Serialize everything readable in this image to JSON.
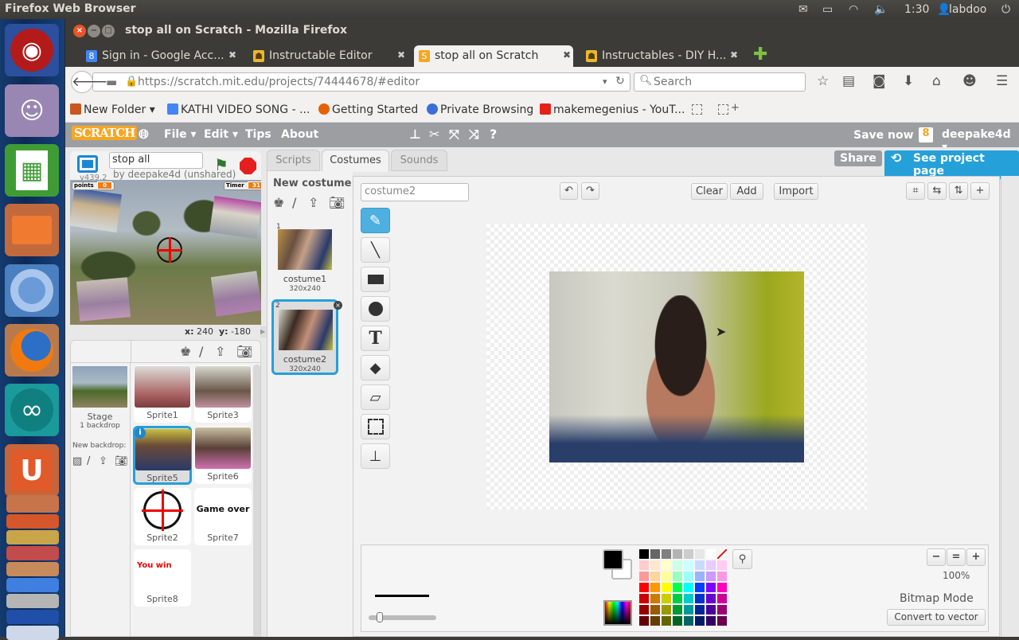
{
  "system": {
    "app_name": "Firefox Web Browser",
    "clock": "1:30",
    "user": "labdoo",
    "indicators": [
      "mail-icon",
      "battery-icon",
      "wifi-icon",
      "volume-icon"
    ]
  },
  "launcher": {
    "items": [
      {
        "name": "ubuntu-dash",
        "glyph": "◉",
        "color": "#b31b1b"
      },
      {
        "name": "cheese-webcam",
        "glyph": "☺",
        "color": "#9a7fb0"
      },
      {
        "name": "libreoffice-calc",
        "glyph": "▦",
        "color": "#3f9c35"
      },
      {
        "name": "files",
        "glyph": "▬",
        "color": "#c36a3d"
      },
      {
        "name": "chromium",
        "glyph": "◎",
        "color": "#4a7fc0"
      },
      {
        "name": "firefox",
        "glyph": "◐",
        "color": "#b87a4d"
      },
      {
        "name": "arduino",
        "glyph": "∞",
        "color": "#1a9a9a"
      },
      {
        "name": "ubuntu-one",
        "glyph": "U",
        "color": "#d4562a"
      }
    ]
  },
  "window": {
    "title": "stop all on Scratch - Mozilla Firefox",
    "tabs": [
      {
        "label": "Sign in - Google Acc...",
        "icon": "google-icon",
        "active": false
      },
      {
        "label": "Instructable Editor",
        "icon": "instructables-icon",
        "active": false
      },
      {
        "label": "stop all on Scratch",
        "icon": "scratch-icon",
        "active": true
      },
      {
        "label": "Instructables - DIY H...",
        "icon": "instructables-icon",
        "active": false
      }
    ],
    "url": "https://scratch.mit.edu/projects/74444678/#editor",
    "search_placeholder": "Search",
    "bookmarks": [
      {
        "label": "New Folder ▾",
        "color": "#c8561e"
      },
      {
        "label": "KATHI VIDEO SONG - ...",
        "color": "#4285f4"
      },
      {
        "label": "Getting Started",
        "color": "#e66000"
      },
      {
        "label": "Private Browsing",
        "color": "#3a6fd8"
      },
      {
        "label": "makemegenius - YouT...",
        "color": "#e62117"
      }
    ]
  },
  "scratch": {
    "logo": "SCRATCH",
    "menu": [
      "File ▾",
      "Edit ▾",
      "Tips",
      "About"
    ],
    "save_now": "Save now",
    "username": "deepake4d ▾",
    "share": "Share",
    "see_project_page": "See project page",
    "project_title": "stop all",
    "version": "v439.2",
    "byline": "by deepake4d (unshared)",
    "stage": {
      "points_label": "points",
      "points_value": "0",
      "timer_label": "Timer",
      "timer_value": "31",
      "mouse_x_label": "x:",
      "mouse_x": "240",
      "mouse_y_label": "y:",
      "mouse_y": "-180"
    },
    "stage_panel": {
      "label": "Stage",
      "backdrops": "1 backdrop",
      "new_backdrop": "New backdrop:"
    },
    "sprites": [
      {
        "name": "Sprite1",
        "selected": false
      },
      {
        "name": "Sprite3",
        "selected": false
      },
      {
        "name": "Sprite5",
        "selected": true
      },
      {
        "name": "Sprite6",
        "selected": false
      },
      {
        "name": "Sprite2",
        "selected": false
      },
      {
        "name": "Sprite7",
        "selected": false,
        "text": "Game over"
      },
      {
        "name": "Sprite8",
        "selected": false,
        "text": "You win"
      }
    ],
    "tabs": [
      "Scripts",
      "Costumes",
      "Sounds"
    ],
    "active_tab": "Costumes",
    "new_costume": "New costume:",
    "costumes": [
      {
        "index": "1",
        "name": "costume1",
        "size": "320x240",
        "selected": false
      },
      {
        "index": "2",
        "name": "costume2",
        "size": "320x240",
        "selected": true
      }
    ],
    "editor": {
      "costume_name": "costume2",
      "clear": "Clear",
      "add": "Add",
      "import": "Import",
      "tools": [
        "brush",
        "line",
        "rectangle",
        "ellipse",
        "text",
        "fill",
        "eraser",
        "select",
        "stamp"
      ],
      "active_tool": "brush",
      "zoom": "100%",
      "mode": "Bitmap Mode",
      "convert": "Convert to vector",
      "brush_size": 0.15,
      "foreground_color": "#000000",
      "background_color": "#ffffff",
      "palette": [
        [
          "#000000",
          "#666666",
          "#808080",
          "#b3b3b3",
          "#cccccc",
          "#e6e6e6",
          "#ffffff",
          "none"
        ],
        [
          "#ffcccc",
          "#ffe6cc",
          "#ffffcc",
          "#ccffe6",
          "#ccffff",
          "#ccd9ff",
          "#e6ccff",
          "#ffccf2"
        ],
        [
          "#ff9999",
          "#ffd699",
          "#ffff99",
          "#99ffbf",
          "#99ffff",
          "#99b3ff",
          "#cc99ff",
          "#ff99e6"
        ],
        [
          "#ff0000",
          "#ff9900",
          "#ffff00",
          "#00ff4d",
          "#00ffff",
          "#0040ff",
          "#8000ff",
          "#ff00bf"
        ],
        [
          "#cc0000",
          "#cc7a00",
          "#cccc00",
          "#00cc44",
          "#00cccc",
          "#0033cc",
          "#6600cc",
          "#cc0099"
        ],
        [
          "#990000",
          "#995c00",
          "#999900",
          "#009933",
          "#009999",
          "#002699",
          "#4d0099",
          "#990073"
        ],
        [
          "#660000",
          "#663d00",
          "#666600",
          "#006622",
          "#006666",
          "#001a66",
          "#330066",
          "#66004d"
        ]
      ]
    }
  }
}
